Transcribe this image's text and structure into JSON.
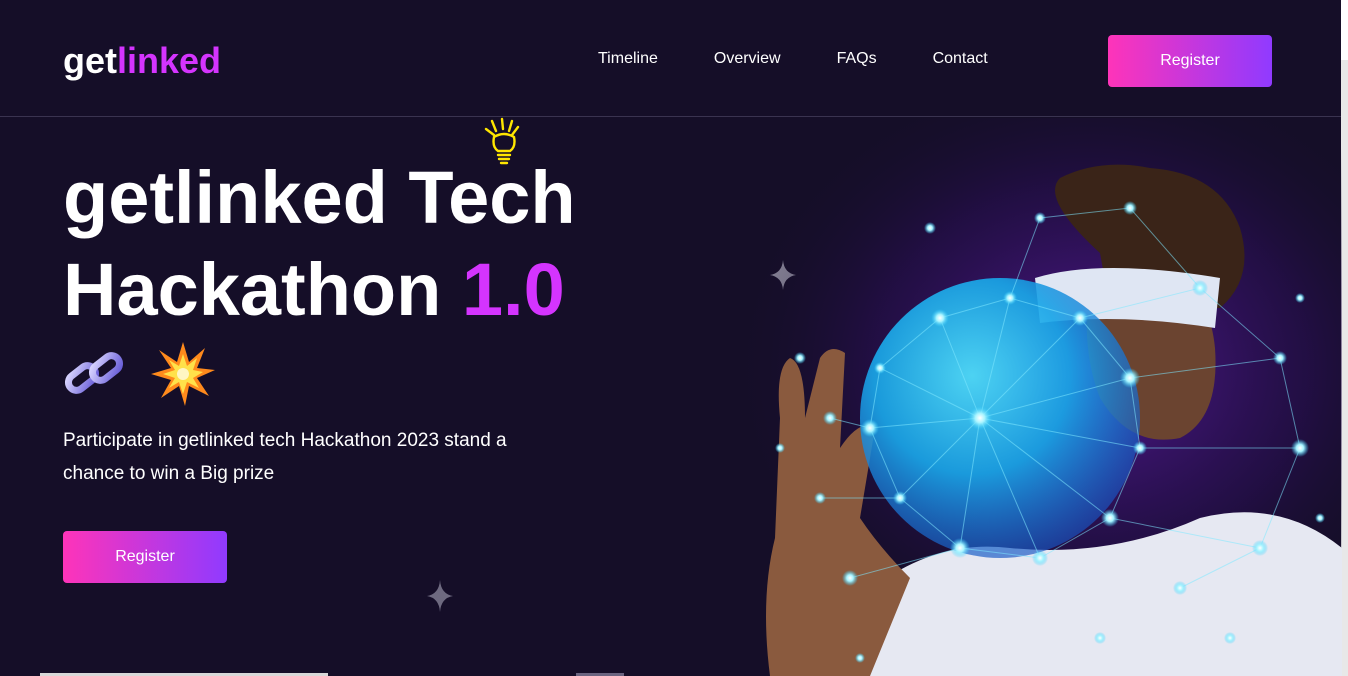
{
  "nav": {
    "logo_main": "get",
    "logo_accent": "linked",
    "links": [
      "Timeline",
      "Overview",
      "FAQs",
      "Contact"
    ],
    "register_label": "Register"
  },
  "hero": {
    "title_line1": "getlinked Tech",
    "title_line2_main": "Hackathon ",
    "title_line2_accent": "1.0",
    "description": "Participate in getlinked tech Hackathon 2023 stand a chance to win a Big prize",
    "register_label": "Register",
    "icons": [
      "light-bulb-icon",
      "chain-link-icon",
      "explosion-icon",
      "sparkle-star-icon"
    ],
    "image": "man-with-vr-headset-holding-glowing-network-globe"
  },
  "colors": {
    "background": "#150e28",
    "accent": "#d434fe",
    "button_gradient_start": "#fe34b9",
    "button_gradient_end": "#903aff"
  }
}
